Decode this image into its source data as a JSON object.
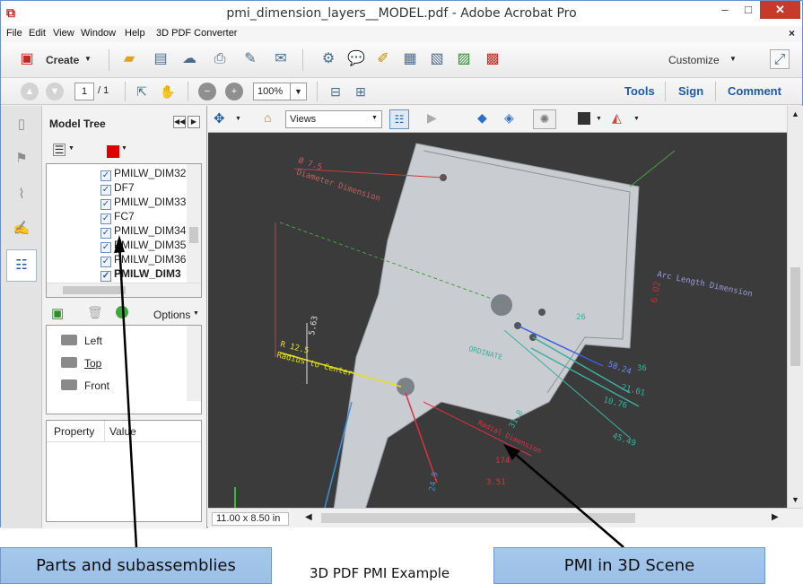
{
  "window": {
    "title": "pmi_dimension_layers__MODEL.pdf - Adobe Acrobat Pro",
    "minimize": "–",
    "maximize": "□",
    "close": "✕"
  },
  "menu": {
    "items": [
      "File",
      "Edit",
      "View",
      "Window",
      "Help",
      "3D PDF Converter"
    ],
    "close": "×"
  },
  "toolbar": {
    "create_label": "Create",
    "customize_label": "Customize"
  },
  "nav": {
    "current_page": "1",
    "page_total": "/ 1",
    "zoom": "100%",
    "tools_label": "Tools",
    "sign_label": "Sign",
    "comment_label": "Comment"
  },
  "model_tree": {
    "title": "Model Tree",
    "items": [
      "PMILW_DIM32",
      "DF7",
      "PMILW_DIM33",
      "FC7",
      "PMILW_DIM34",
      "PMILW_DIM35",
      "PMILW_DIM36",
      "PMILW_DIM3"
    ],
    "options_label": "Options",
    "views": [
      "Left",
      "Top",
      "Front"
    ],
    "property_header": "Property",
    "value_header": "Value"
  },
  "viewer": {
    "views_select": "Views",
    "page_size": "11.00 x 8.50 in"
  },
  "scene_labels": {
    "diameter_dim": "Diameter Dimension",
    "diameter_val": "Ø 7.5",
    "radius_label": "Radius to Center",
    "radius_val": "R 12.5",
    "arc_length": "Arc Length Dimension",
    "v_5_63": "5.63",
    "v_58_24": "58.24",
    "v_36": "36",
    "v_21_01": "21.01",
    "v_10_76": "10.76",
    "v_26": "26",
    "v_45_49": "45.49",
    "v_31_8": "31.8",
    "v_3_51": "3.51",
    "v_174": "174",
    "v_24_9": "24.9",
    "v_6_02": "6.02",
    "ordinate": "ORDINATE",
    "radial_dimension": "Radial Dimension"
  },
  "annotations": {
    "left_callout": "Parts and subassemblies",
    "right_callout": "PMI in 3D Scene",
    "caption": "3D PDF PMI Example"
  },
  "colors": {
    "title_close": "#c7392b",
    "link_blue": "#1f5aa0",
    "callout_fill": "#a6c8ec",
    "scene_bg": "#3b3b3b"
  }
}
